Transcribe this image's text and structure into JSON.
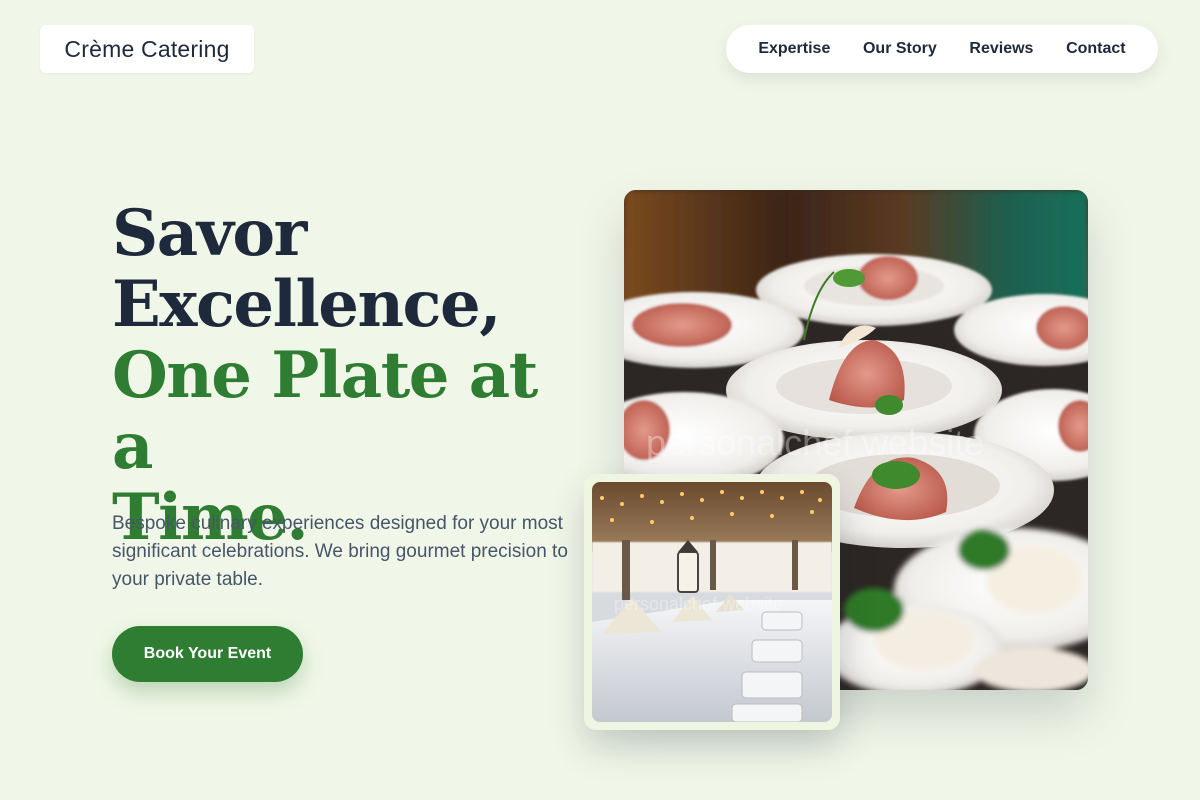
{
  "brand": {
    "name": "Crème Catering"
  },
  "nav": {
    "items": [
      {
        "label": "Expertise"
      },
      {
        "label": "Our Story"
      },
      {
        "label": "Reviews"
      },
      {
        "label": "Contact"
      }
    ]
  },
  "hero": {
    "headline_line1": "Savor",
    "headline_line2": "Excellence,",
    "headline_line3": "One Plate at a",
    "headline_line4": "Time.",
    "subtitle": "Bespoke culinary experiences designed for your most significant celebrations. We bring gourmet precision to your private table.",
    "cta_label": "Book Your Event"
  },
  "images": {
    "main_watermark": "personalchef website",
    "small_watermark": "personalchef website"
  },
  "colors": {
    "background": "#f1f7e8",
    "accent_green": "#2e7d32",
    "text_dark": "#1e293b",
    "text_muted": "#475569"
  }
}
